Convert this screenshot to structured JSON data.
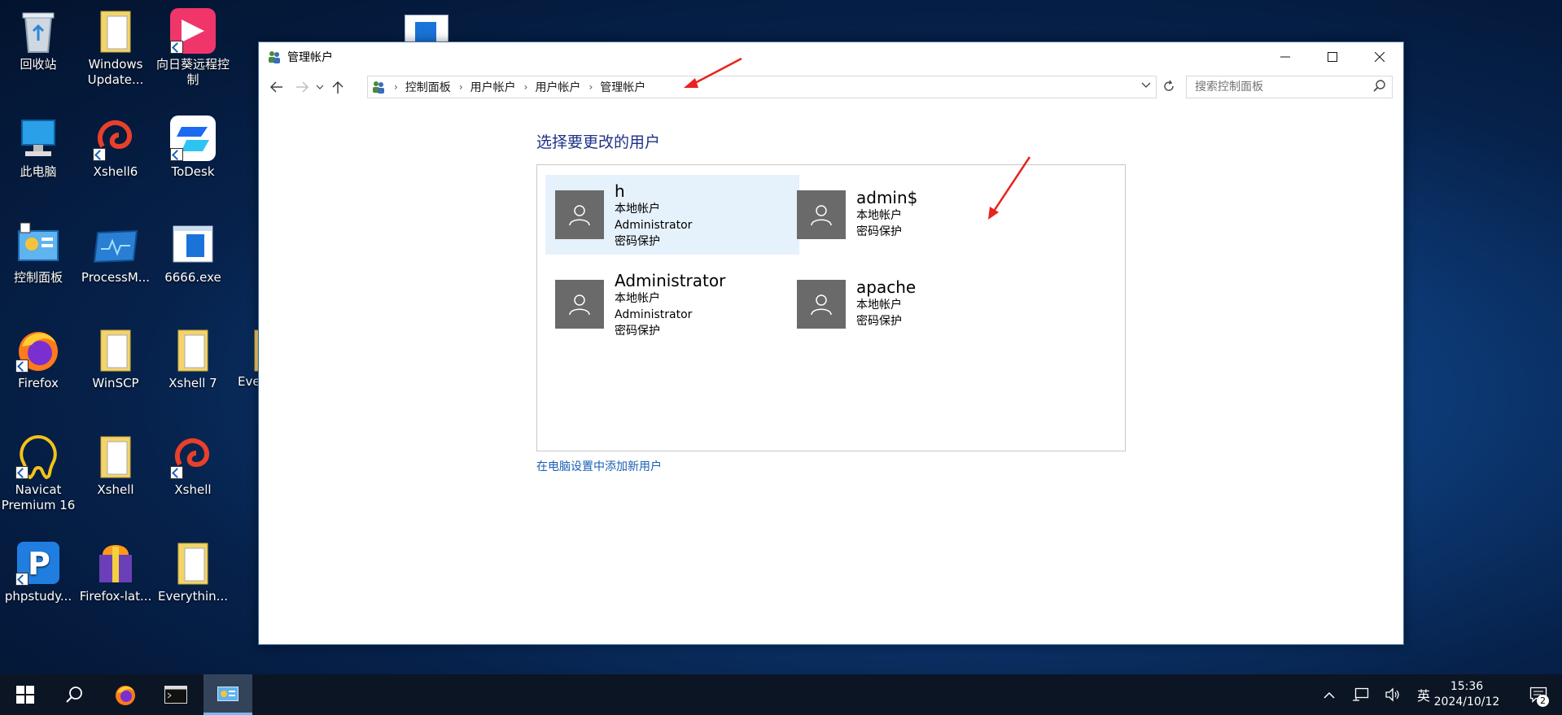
{
  "desktop": {
    "icons": [
      {
        "label": "回收站"
      },
      {
        "label": "Windows Update..."
      },
      {
        "label": "向日葵远程控制"
      },
      {
        "label": "此电脑"
      },
      {
        "label": "Xshell6"
      },
      {
        "label": "ToDesk"
      },
      {
        "label": "控制面板"
      },
      {
        "label": "ProcessM..."
      },
      {
        "label": "6666.exe"
      },
      {
        "label": "Firefox"
      },
      {
        "label": "WinSCP"
      },
      {
        "label": "Xshell 7"
      },
      {
        "label": "Eve"
      },
      {
        "label": "Navicat Premium 16"
      },
      {
        "label": "Xshell"
      },
      {
        "label": "Xshell"
      },
      {
        "label": "phpstudy..."
      },
      {
        "label": "Firefox-lat..."
      },
      {
        "label": "Everythin..."
      }
    ]
  },
  "window": {
    "title": "管理帐户",
    "breadcrumb": [
      "控制面板",
      "用户帐户",
      "用户帐户",
      "管理帐户"
    ],
    "search_placeholder": "搜索控制面板",
    "heading": "选择要更改的用户",
    "users": [
      {
        "name": "h",
        "lines": [
          "本地帐户",
          "Administrator",
          "密码保护"
        ],
        "selected": true
      },
      {
        "name": "admin$",
        "lines": [
          "本地帐户",
          "密码保护"
        ],
        "selected": false
      },
      {
        "name": "Administrator",
        "lines": [
          "本地帐户",
          "Administrator",
          "密码保护"
        ],
        "selected": false
      },
      {
        "name": "apache",
        "lines": [
          "本地帐户",
          "密码保护"
        ],
        "selected": false
      }
    ],
    "add_user_link": "在电脑设置中添加新用户"
  },
  "taskbar": {
    "ime": "英",
    "time": "15:36",
    "date": "2024/10/12",
    "notification_count": "2"
  },
  "colors": {
    "accent": "#1e3287",
    "link": "#1a5fb4",
    "selection": "#e5f1fb",
    "annotation_arrow": "#e8231f"
  }
}
